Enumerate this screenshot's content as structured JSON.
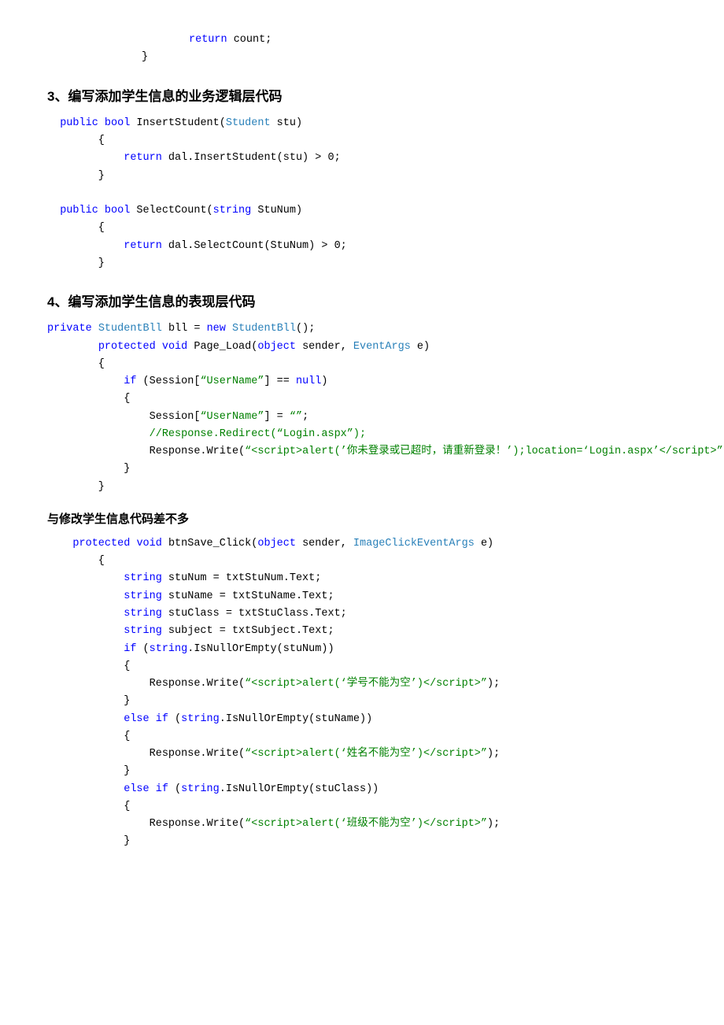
{
  "sections": [
    {
      "id": "section-top-code",
      "lines": [
        {
          "indent": 3,
          "parts": [
            {
              "text": "return",
              "cls": "kw-blue"
            },
            {
              "text": " count;",
              "cls": "plain"
            }
          ]
        },
        {
          "indent": 2,
          "parts": [
            {
              "text": "}",
              "cls": "plain"
            }
          ]
        }
      ]
    },
    {
      "id": "section3",
      "heading": "3、编写添加学生信息的业务逻辑层代码"
    },
    {
      "id": "section3-code",
      "lines": [
        {
          "indent": 1,
          "parts": [
            {
              "text": "public",
              "cls": "kw-blue"
            },
            {
              "text": " ",
              "cls": "plain"
            },
            {
              "text": "bool",
              "cls": "kw-blue"
            },
            {
              "text": " InsertStudent(",
              "cls": "plain"
            },
            {
              "text": "Student",
              "cls": "type-teal"
            },
            {
              "text": " stu)",
              "cls": "plain"
            }
          ]
        },
        {
          "indent": 2,
          "parts": [
            {
              "text": "{",
              "cls": "plain"
            }
          ]
        },
        {
          "indent": 3,
          "parts": [
            {
              "text": "return",
              "cls": "kw-blue"
            },
            {
              "text": " dal.InsertStudent(stu) > 0;",
              "cls": "plain"
            }
          ]
        },
        {
          "indent": 2,
          "parts": [
            {
              "text": "}",
              "cls": "plain"
            }
          ]
        },
        {
          "indent": 0,
          "parts": [
            {
              "text": "",
              "cls": "plain"
            }
          ]
        },
        {
          "indent": 1,
          "parts": [
            {
              "text": "public",
              "cls": "kw-blue"
            },
            {
              "text": " ",
              "cls": "plain"
            },
            {
              "text": "bool",
              "cls": "kw-blue"
            },
            {
              "text": " SelectCount(",
              "cls": "plain"
            },
            {
              "text": "string",
              "cls": "kw-blue"
            },
            {
              "text": " StuNum)",
              "cls": "plain"
            }
          ]
        },
        {
          "indent": 2,
          "parts": [
            {
              "text": "{",
              "cls": "plain"
            }
          ]
        },
        {
          "indent": 3,
          "parts": [
            {
              "text": "return",
              "cls": "kw-blue"
            },
            {
              "text": " dal.SelectCount(StuNum) > 0;",
              "cls": "plain"
            }
          ]
        },
        {
          "indent": 2,
          "parts": [
            {
              "text": "}",
              "cls": "plain"
            }
          ]
        }
      ]
    },
    {
      "id": "section4",
      "heading": "4、编写添加学生信息的表现层代码"
    },
    {
      "id": "section4-code",
      "lines": [
        {
          "indent": 0,
          "parts": [
            {
              "text": "private",
              "cls": "kw-blue"
            },
            {
              "text": " ",
              "cls": "plain"
            },
            {
              "text": "StudentBll",
              "cls": "type-teal"
            },
            {
              "text": " bll = ",
              "cls": "plain"
            },
            {
              "text": "new",
              "cls": "kw-blue"
            },
            {
              "text": " ",
              "cls": "plain"
            },
            {
              "text": "StudentBll",
              "cls": "type-teal"
            },
            {
              "text": "();",
              "cls": "plain"
            }
          ]
        },
        {
          "indent": 2,
          "parts": [
            {
              "text": "protected",
              "cls": "kw-blue"
            },
            {
              "text": " ",
              "cls": "plain"
            },
            {
              "text": "void",
              "cls": "kw-blue"
            },
            {
              "text": " Page_Load(",
              "cls": "plain"
            },
            {
              "text": "object",
              "cls": "kw-blue"
            },
            {
              "text": " sender, ",
              "cls": "plain"
            },
            {
              "text": "EventArgs",
              "cls": "type-teal"
            },
            {
              "text": " e)",
              "cls": "plain"
            }
          ]
        },
        {
          "indent": 2,
          "parts": [
            {
              "text": "{",
              "cls": "plain"
            }
          ]
        },
        {
          "indent": 3,
          "parts": [
            {
              "text": "if",
              "cls": "kw-blue"
            },
            {
              "text": " (Session[",
              "cls": "plain"
            },
            {
              "text": "“UserName”",
              "cls": "string-green"
            },
            {
              "text": "] == ",
              "cls": "plain"
            },
            {
              "text": "null",
              "cls": "kw-blue"
            },
            {
              "text": ")",
              "cls": "plain"
            }
          ]
        },
        {
          "indent": 3,
          "parts": [
            {
              "text": "{",
              "cls": "plain"
            }
          ]
        },
        {
          "indent": 4,
          "parts": [
            {
              "text": "Session[",
              "cls": "plain"
            },
            {
              "text": "“UserName”",
              "cls": "string-green"
            },
            {
              "text": "] = ",
              "cls": "plain"
            },
            {
              "text": "“”",
              "cls": "string-green"
            },
            {
              "text": ";",
              "cls": "plain"
            }
          ]
        },
        {
          "indent": 4,
          "parts": [
            {
              "text": "//Response.Redirect(“Login.aspx”);",
              "cls": "comment-green"
            }
          ]
        },
        {
          "indent": 4,
          "parts": [
            {
              "text": "Response.Write(",
              "cls": "plain"
            },
            {
              "text": "\"<script>alert('你未登录或已超时，请重新登录！');location='Login.aspx'<\\/script>\"",
              "cls": "string-green"
            },
            {
              "text": ");",
              "cls": "plain"
            }
          ]
        },
        {
          "indent": 3,
          "parts": [
            {
              "text": "}",
              "cls": "plain"
            }
          ]
        },
        {
          "indent": 2,
          "parts": [
            {
              "text": "}",
              "cls": "plain"
            }
          ]
        }
      ]
    },
    {
      "id": "note",
      "text": "与修改学生信息代码差不多"
    },
    {
      "id": "section-save-code",
      "lines": [
        {
          "indent": 1,
          "parts": [
            {
              "text": "protected",
              "cls": "kw-blue"
            },
            {
              "text": " ",
              "cls": "plain"
            },
            {
              "text": "void",
              "cls": "kw-blue"
            },
            {
              "text": " btnSave_Click(",
              "cls": "plain"
            },
            {
              "text": "object",
              "cls": "kw-blue"
            },
            {
              "text": " sender, ",
              "cls": "plain"
            },
            {
              "text": "ImageClickEventArgs",
              "cls": "type-teal"
            },
            {
              "text": " e)",
              "cls": "plain"
            }
          ]
        },
        {
          "indent": 2,
          "parts": [
            {
              "text": "{",
              "cls": "plain"
            }
          ]
        },
        {
          "indent": 3,
          "parts": [
            {
              "text": "string",
              "cls": "kw-blue"
            },
            {
              "text": " stuNum = txtStuNum.Text;",
              "cls": "plain"
            }
          ]
        },
        {
          "indent": 3,
          "parts": [
            {
              "text": "string",
              "cls": "kw-blue"
            },
            {
              "text": " stuName = txtStuName.Text;",
              "cls": "plain"
            }
          ]
        },
        {
          "indent": 3,
          "parts": [
            {
              "text": "string",
              "cls": "kw-blue"
            },
            {
              "text": " stuClass = txtStuClass.Text;",
              "cls": "plain"
            }
          ]
        },
        {
          "indent": 3,
          "parts": [
            {
              "text": "string",
              "cls": "kw-blue"
            },
            {
              "text": " subject = txtSubject.Text;",
              "cls": "plain"
            }
          ]
        },
        {
          "indent": 3,
          "parts": [
            {
              "text": "if",
              "cls": "kw-blue"
            },
            {
              "text": " (",
              "cls": "plain"
            },
            {
              "text": "string",
              "cls": "kw-blue"
            },
            {
              "text": ".IsNullOrEmpty(stuNum))",
              "cls": "plain"
            }
          ]
        },
        {
          "indent": 3,
          "parts": [
            {
              "text": "{",
              "cls": "plain"
            }
          ]
        },
        {
          "indent": 4,
          "parts": [
            {
              "text": "Response.Write(",
              "cls": "plain"
            },
            {
              "text": "\"<script>alert('学号不能为空')<\\/script>\"",
              "cls": "string-green"
            },
            {
              "text": ");",
              "cls": "plain"
            }
          ]
        },
        {
          "indent": 3,
          "parts": [
            {
              "text": "}",
              "cls": "plain"
            }
          ]
        },
        {
          "indent": 3,
          "parts": [
            {
              "text": "else",
              "cls": "kw-blue"
            },
            {
              "text": " ",
              "cls": "plain"
            },
            {
              "text": "if",
              "cls": "kw-blue"
            },
            {
              "text": " (",
              "cls": "plain"
            },
            {
              "text": "string",
              "cls": "kw-blue"
            },
            {
              "text": ".IsNullOrEmpty(stuName))",
              "cls": "plain"
            }
          ]
        },
        {
          "indent": 3,
          "parts": [
            {
              "text": "{",
              "cls": "plain"
            }
          ]
        },
        {
          "indent": 4,
          "parts": [
            {
              "text": "Response.Write(",
              "cls": "plain"
            },
            {
              "text": "\"<script>alert('姓名不能为空')<\\/script>\"",
              "cls": "string-green"
            },
            {
              "text": ");",
              "cls": "plain"
            }
          ]
        },
        {
          "indent": 3,
          "parts": [
            {
              "text": "}",
              "cls": "plain"
            }
          ]
        },
        {
          "indent": 3,
          "parts": [
            {
              "text": "else",
              "cls": "kw-blue"
            },
            {
              "text": " ",
              "cls": "plain"
            },
            {
              "text": "if",
              "cls": "kw-blue"
            },
            {
              "text": " (",
              "cls": "plain"
            },
            {
              "text": "string",
              "cls": "kw-blue"
            },
            {
              "text": ".IsNullOrEmpty(stuClass))",
              "cls": "plain"
            }
          ]
        },
        {
          "indent": 3,
          "parts": [
            {
              "text": "{",
              "cls": "plain"
            }
          ]
        },
        {
          "indent": 4,
          "parts": [
            {
              "text": "Response.Write(",
              "cls": "plain"
            },
            {
              "text": "\"<script>alert('班级不能为空')<\\/script>\"",
              "cls": "string-green"
            },
            {
              "text": ");",
              "cls": "plain"
            }
          ]
        },
        {
          "indent": 3,
          "parts": [
            {
              "text": "}",
              "cls": "plain"
            }
          ]
        }
      ]
    }
  ]
}
